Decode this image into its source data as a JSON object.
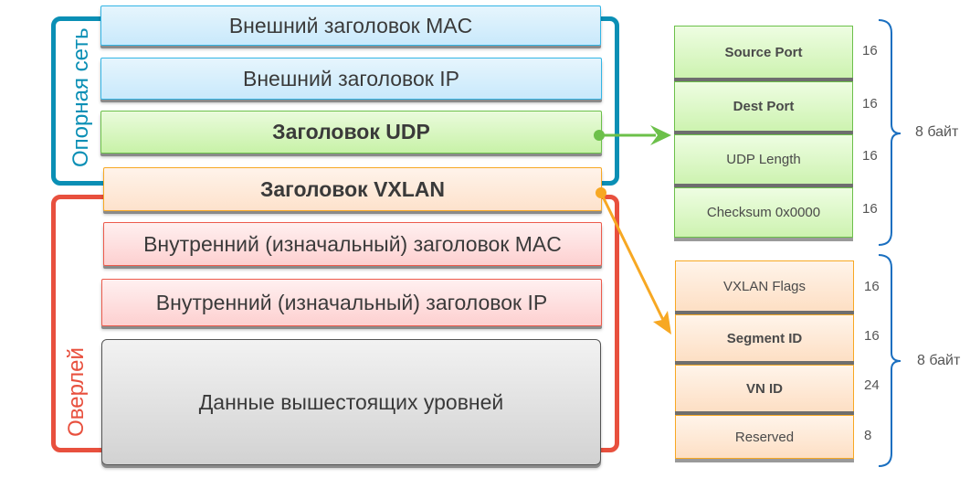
{
  "brackets": {
    "underlay_label": "Опорная сеть",
    "overlay_label": "Оверлей",
    "underlay_color": "#0a8fb5",
    "overlay_color": "#e8503e"
  },
  "layers": [
    {
      "label": "Внешний заголовок MAC",
      "style": "blue"
    },
    {
      "label": "Внешний заголовок IP",
      "style": "blue"
    },
    {
      "label": "Заголовок UDP",
      "style": "green"
    },
    {
      "label": "Заголовок VXLAN",
      "style": "orange"
    },
    {
      "label": "Внутренний (изначальный) заголовок MAC",
      "style": "red"
    },
    {
      "label": "Внутренний (изначальный) заголовок IP",
      "style": "red"
    },
    {
      "label": "Данные вышестоящих уровней",
      "style": "gray"
    }
  ],
  "udp_fields": [
    {
      "label": "Source Port",
      "bits": "16",
      "bold": true
    },
    {
      "label": "Dest Port",
      "bits": "16",
      "bold": true
    },
    {
      "label": "UDP Length",
      "bits": "16",
      "bold": false
    },
    {
      "label": "Checksum 0x0000",
      "bits": "16",
      "bold": false
    }
  ],
  "udp_total": "8 байт",
  "vxlan_fields": [
    {
      "label": "VXLAN Flags",
      "bits": "16",
      "bold": false
    },
    {
      "label": "Segment ID",
      "bits": "16",
      "bold": true
    },
    {
      "label": "VN ID",
      "bits": "24",
      "bold": true
    },
    {
      "label": "Reserved",
      "bits": "8",
      "bold": false
    }
  ],
  "vxlan_total": "8 байт",
  "colors": {
    "udp_arrow": "#6cc04a",
    "vxlan_arrow": "#f7a823",
    "brace": "#1a6fc0"
  }
}
